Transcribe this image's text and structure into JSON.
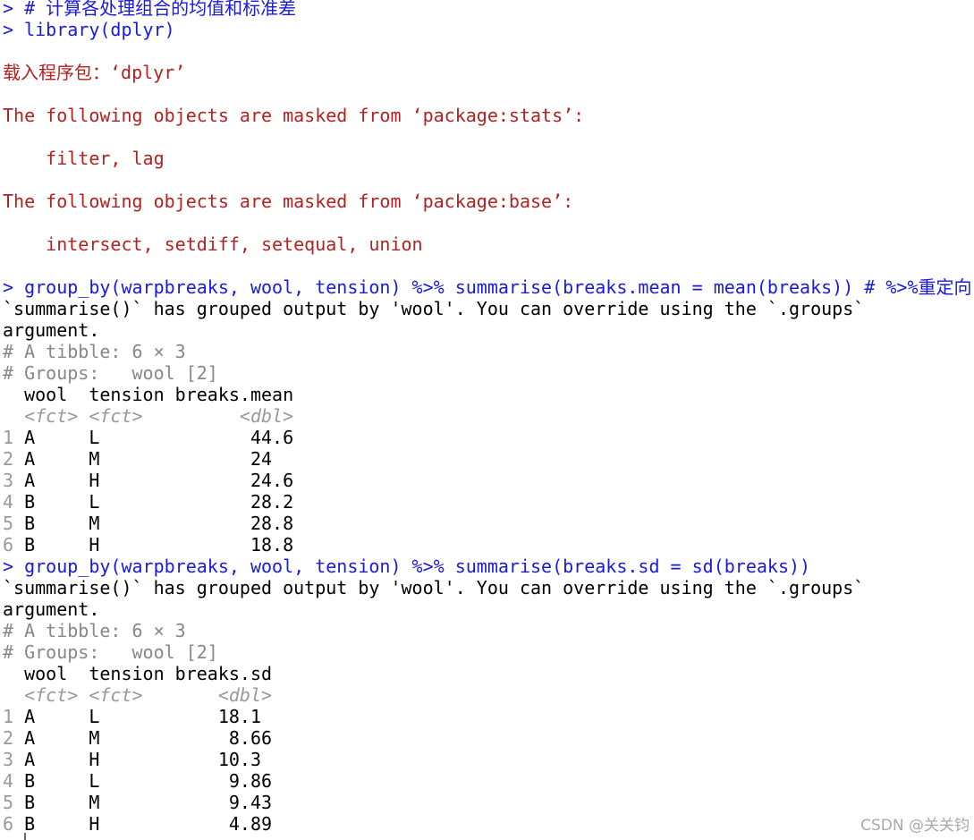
{
  "console": {
    "lines": [
      {
        "text": "> # 计算各处理组合的均值和标准差",
        "color": "#1a1adb",
        "kind": "input"
      },
      {
        "text": "> library(dplyr)",
        "color": "#1a1adb",
        "kind": "input"
      },
      {
        "text": "",
        "color": "#000000",
        "kind": "blank"
      },
      {
        "text": "载入程序包：‘dplyr’",
        "color": "#b22222",
        "kind": "message"
      },
      {
        "text": "",
        "color": "#000000",
        "kind": "blank"
      },
      {
        "text": "The following objects are masked from ‘package:stats’:",
        "color": "#b22222",
        "kind": "message"
      },
      {
        "text": "",
        "color": "#000000",
        "kind": "blank"
      },
      {
        "text": "    filter, lag",
        "color": "#b22222",
        "kind": "message"
      },
      {
        "text": "",
        "color": "#000000",
        "kind": "blank"
      },
      {
        "text": "The following objects are masked from ‘package:base’:",
        "color": "#b22222",
        "kind": "message"
      },
      {
        "text": "",
        "color": "#000000",
        "kind": "blank"
      },
      {
        "text": "    intersect, setdiff, setequal, union",
        "color": "#b22222",
        "kind": "message"
      },
      {
        "text": "",
        "color": "#000000",
        "kind": "blank"
      },
      {
        "text": "> group_by(warpbreaks, wool, tension) %>% summarise(breaks.mean = mean(breaks)) # %>%重定向",
        "color": "#1a1adb",
        "kind": "input"
      },
      {
        "text": "`summarise()` has grouped output by 'wool'. You can override using the `.groups`",
        "color": "#000000",
        "kind": "output"
      },
      {
        "text": "argument.",
        "color": "#000000",
        "kind": "output"
      },
      {
        "text": "# A tibble: 6 × 3",
        "color": "#888888",
        "kind": "meta"
      },
      {
        "text": "# Groups:   wool [2]",
        "color": "#888888",
        "kind": "meta"
      },
      {
        "text": "  wool  tension breaks.mean",
        "color": "#000000",
        "kind": "output"
      },
      {
        "text": "  <fct> <fct>         <dbl>",
        "color": "#999999",
        "kind": "type"
      },
      {
        "text": "1 A     L              44.6",
        "color": "#000000",
        "kind": "row"
      },
      {
        "text": "2 A     M              24  ",
        "color": "#000000",
        "kind": "row"
      },
      {
        "text": "3 A     H              24.6",
        "color": "#000000",
        "kind": "row"
      },
      {
        "text": "4 B     L              28.2",
        "color": "#000000",
        "kind": "row"
      },
      {
        "text": "5 B     M              28.8",
        "color": "#000000",
        "kind": "row"
      },
      {
        "text": "6 B     H              18.8",
        "color": "#000000",
        "kind": "row"
      },
      {
        "text": "> group_by(warpbreaks, wool, tension) %>% summarise(breaks.sd = sd(breaks))",
        "color": "#1a1adb",
        "kind": "input"
      },
      {
        "text": "`summarise()` has grouped output by 'wool'. You can override using the `.groups`",
        "color": "#000000",
        "kind": "output"
      },
      {
        "text": "argument.",
        "color": "#000000",
        "kind": "output"
      },
      {
        "text": "# A tibble: 6 × 3",
        "color": "#888888",
        "kind": "meta"
      },
      {
        "text": "# Groups:   wool [2]",
        "color": "#888888",
        "kind": "meta"
      },
      {
        "text": "  wool  tension breaks.sd",
        "color": "#000000",
        "kind": "output"
      },
      {
        "text": "  <fct> <fct>       <dbl>",
        "color": "#999999",
        "kind": "type"
      },
      {
        "text": "1 A     L           18.1 ",
        "color": "#000000",
        "kind": "row"
      },
      {
        "text": "2 A     M            8.66",
        "color": "#000000",
        "kind": "row"
      },
      {
        "text": "3 A     H           10.3 ",
        "color": "#000000",
        "kind": "row"
      },
      {
        "text": "4 B     L            9.86",
        "color": "#000000",
        "kind": "row"
      },
      {
        "text": "5 B     M            9.43",
        "color": "#000000",
        "kind": "row"
      },
      {
        "text": "6 B     H            4.89",
        "color": "#000000",
        "kind": "row"
      }
    ]
  },
  "watermark": "CSDN @关关钧"
}
